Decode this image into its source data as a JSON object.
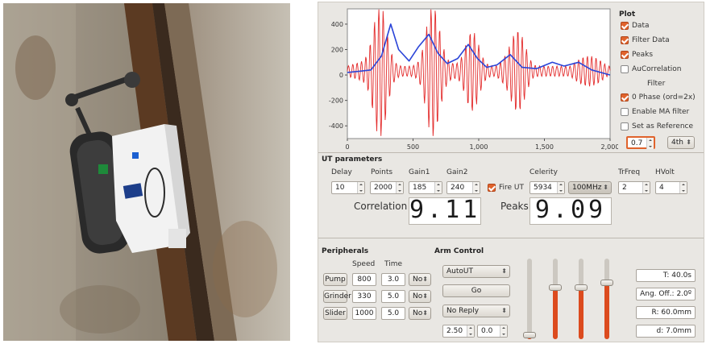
{
  "plot": {
    "section_title": "Plot",
    "checks": [
      {
        "label": "Data",
        "checked": true
      },
      {
        "label": "Filter Data",
        "checked": true
      },
      {
        "label": "Peaks",
        "checked": true
      },
      {
        "label": "AuCorrelation",
        "checked": false
      }
    ],
    "filter_title": "Filter",
    "filter_checks": [
      {
        "label": "0 Phase  (ord=2x)",
        "checked": true
      },
      {
        "label": "Enable MA filter",
        "checked": false
      },
      {
        "label": "Set as Reference",
        "checked": false
      }
    ],
    "filter_value": "0.7",
    "filter_order": "4th"
  },
  "chart_data": {
    "type": "line",
    "x_ticks": [
      "0",
      "500",
      "1,000",
      "1,500",
      "2,000"
    ],
    "y_ticks": [
      "400",
      "200",
      "0",
      "-200",
      "-400"
    ],
    "xlim": [
      0,
      2000
    ],
    "ylim": [
      -500,
      520
    ],
    "series": [
      {
        "color": "#e32b2b",
        "wave_envelope": [
          {
            "x": 250,
            "y": 480
          },
          {
            "x": 650,
            "y": 460
          },
          {
            "x": 950,
            "y": 280
          },
          {
            "x": 1300,
            "y": 210
          }
        ]
      },
      {
        "color": "#2a44d8",
        "values": [
          [
            0,
            20
          ],
          [
            100,
            30
          ],
          [
            180,
            40
          ],
          [
            260,
            150
          ],
          [
            330,
            400
          ],
          [
            390,
            200
          ],
          [
            470,
            110
          ],
          [
            540,
            220
          ],
          [
            620,
            320
          ],
          [
            690,
            170
          ],
          [
            760,
            90
          ],
          [
            840,
            130
          ],
          [
            920,
            240
          ],
          [
            990,
            130
          ],
          [
            1060,
            60
          ],
          [
            1140,
            80
          ],
          [
            1240,
            160
          ],
          [
            1330,
            60
          ],
          [
            1440,
            50
          ],
          [
            1560,
            100
          ],
          [
            1650,
            70
          ],
          [
            1760,
            100
          ],
          [
            1860,
            40
          ],
          [
            2000,
            0
          ]
        ]
      }
    ],
    "grid": false
  },
  "ut": {
    "section_title": "UT parameters",
    "headers": [
      "Delay",
      "Points",
      "Gain1",
      "Gain2",
      "Celerity",
      "TrFreq",
      "HVolt"
    ],
    "delay": "10",
    "points": "2000",
    "gain1": "185",
    "gain2": "240",
    "fire_ut_label": "Fire UT",
    "celerity": "5934",
    "mhz": "100MHz",
    "trfreq": "2",
    "hvolt": "4",
    "correlation_label": "Correlation",
    "correlation_value": "9.11",
    "peaks_label": "Peaks",
    "peaks_value": "9.09"
  },
  "peripherals": {
    "section_title": "Peripherals",
    "speed_header": "Speed",
    "time_header": "Time",
    "rows": [
      {
        "name": "Pump",
        "speed": "800",
        "time": "3.0",
        "state": "No"
      },
      {
        "name": "Grinder",
        "speed": "330",
        "time": "5.0",
        "state": "No"
      },
      {
        "name": "Slider",
        "speed": "1000",
        "time": "5.0",
        "state": "No"
      }
    ]
  },
  "arm": {
    "section_title": "Arm Control",
    "mode": "AutoUT",
    "go_label": "Go",
    "reply": "No Reply",
    "value_a": "2.50",
    "value_b": "0.0",
    "sliders": [
      0.05,
      0.64,
      0.64,
      0.7
    ]
  },
  "status": {
    "time": "T: 40.0s",
    "angle_offset": "Ang. Off.: 2.0º",
    "radius": "R: 60.0mm",
    "depth": "d: 7.0mm"
  }
}
